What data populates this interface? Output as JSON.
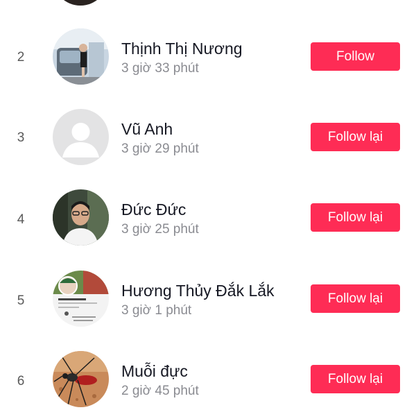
{
  "followers": [
    {
      "rank": "2",
      "name": "Thịnh  Thị  Nương",
      "time": "3 giờ 33 phút",
      "button": "Follow",
      "avatar": "photo-avatar-car"
    },
    {
      "rank": "3",
      "name": "Vũ Anh",
      "time": "3 giờ 29 phút",
      "button": "Follow lại",
      "avatar": "default-avatar"
    },
    {
      "rank": "4",
      "name": "Đức Đức",
      "time": "3 giờ 25 phút",
      "button": "Follow lại",
      "avatar": "photo-avatar-man"
    },
    {
      "rank": "5",
      "name": "Hương Thủy Đắk Lắk",
      "time": "3 giờ 1 phút",
      "button": "Follow lại",
      "avatar": "photo-avatar-profile-screenshot"
    },
    {
      "rank": "6",
      "name": "Muỗi đực",
      "time": "2 giờ 45 phút",
      "button": "Follow lại",
      "avatar": "photo-avatar-mosquito"
    }
  ],
  "colors": {
    "accent": "#fe2c55",
    "name": "#161823",
    "secondary": "#8a8b91"
  }
}
